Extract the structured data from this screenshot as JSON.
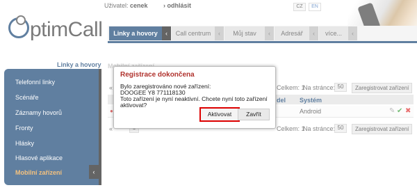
{
  "header": {
    "user_label": "Uživatel:",
    "user_name": "cenek",
    "logout_label": "odhlásit",
    "lang_cz": "CZ",
    "lang_en": "EN",
    "logo_text": "ptimCall"
  },
  "tabs": {
    "active": "Linky a hovory",
    "items": [
      "Call centrum",
      "Můj stav",
      "Adresář",
      "více..."
    ]
  },
  "sidebar": {
    "title": "Linky a hovory",
    "items": [
      "Telefonní linky",
      "Scénáře",
      "Záznamy hovorů",
      "Fronty",
      "Hlásky",
      "Hlasové aplikace",
      "Mobilní zařízení"
    ],
    "active": "Mobilní zařízení"
  },
  "main": {
    "page_title_partial": "Mobilní zařízení",
    "total_label": "Celkem: 1",
    "per_page_label": "Na stránce:",
    "per_page_value": "50",
    "register_button": "Zaregistrovat zařízení",
    "columns": [
      "del",
      "Systém"
    ],
    "row": {
      "system": "Android"
    },
    "page_value": "1"
  },
  "dialog": {
    "title": "Registrace dokončena",
    "line1": "Bylo zaregistrováno nové zařízení:",
    "line2": "DOOGEE Y8 771118130",
    "line3": "Toto zařízení je nyní neaktivní. Chcete nyní toto zařízení",
    "line4": "aktivovat?",
    "activate_button": "Aktivovat",
    "close_button": "Zavřít"
  }
}
